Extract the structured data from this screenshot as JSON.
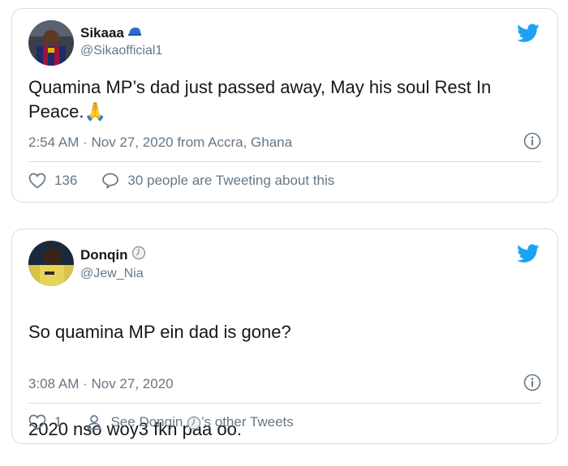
{
  "tweets": [
    {
      "display_name": "Sikaaa",
      "handle": "@Sikaofficial1",
      "text": "Quamina MP’s dad just passed away, May his soul Rest In Peace.",
      "emoji": "🙏",
      "timestamp": "2:54 AM · Nov 27, 2020 from Accra, Ghana",
      "likes": "136",
      "secondary_action": "30 people are Tweeting about this",
      "icons": [
        "cap-emoji-icon",
        "twitter-bird-icon",
        "info-icon",
        "heart-icon",
        "speech-bubble-icon"
      ]
    },
    {
      "display_name": "Donqin",
      "handle": "@Jew_Nia",
      "text_line1": "So quamina MP ein dad is gone?",
      "text_line2": "2020 nso woy3 fkn paa oo.",
      "timestamp": "3:08 AM · Nov 27, 2020",
      "likes": "1",
      "secondary_action_prefix": "See Donqin",
      "secondary_action_suffix": "’s other Tweets",
      "icons": [
        "clock-badge-icon",
        "twitter-bird-icon",
        "info-icon",
        "heart-icon",
        "person-icon"
      ]
    }
  ],
  "colors": {
    "text_primary": "#14171a",
    "text_secondary": "#657786",
    "twitter_blue": "#1da1f2",
    "border": "#d6dbe0"
  }
}
